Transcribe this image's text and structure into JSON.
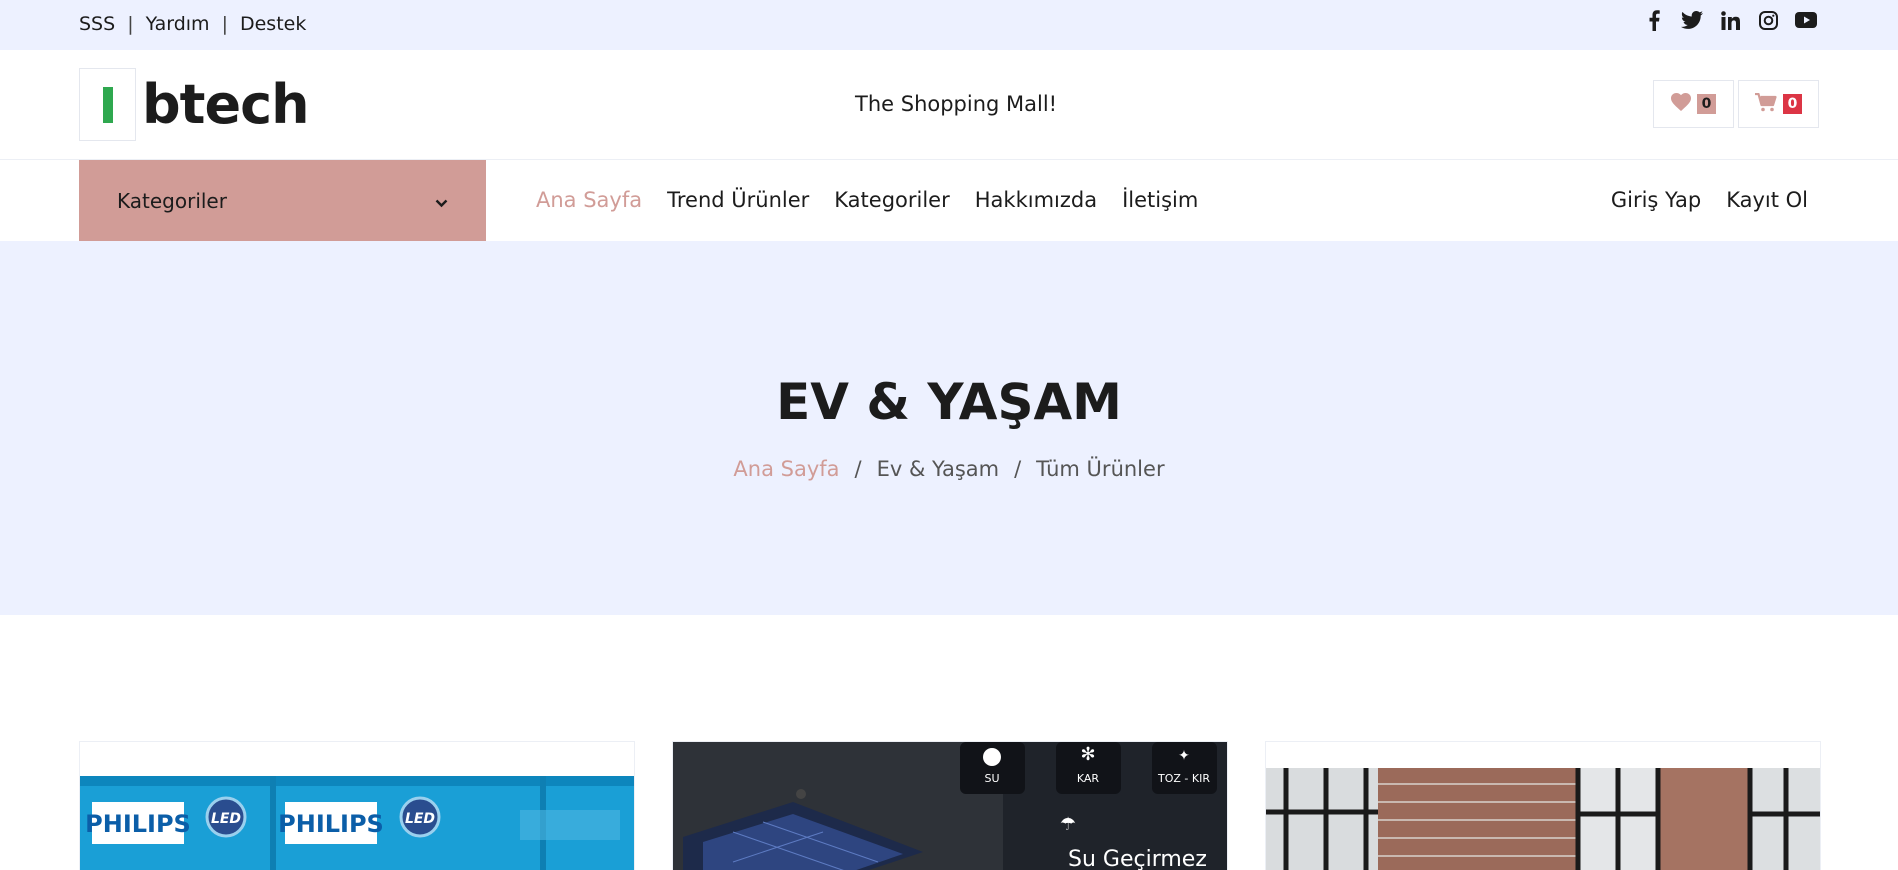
{
  "topbar": {
    "links": [
      "SSS",
      "Yardım",
      "Destek"
    ],
    "separator": "|",
    "social_icons": [
      "facebook-icon",
      "twitter-icon",
      "linkedin-icon",
      "instagram-icon",
      "youtube-icon"
    ]
  },
  "header": {
    "logo_text": "btech",
    "tagline": "The Shopping Mall!",
    "wishlist_count": "0",
    "cart_count": "0"
  },
  "nav": {
    "categories_label": "Kategoriler",
    "menu": [
      "Ana Sayfa",
      "Trend Ürünler",
      "Kategoriler",
      "Hakkımızda",
      "İletişim"
    ],
    "active_item": "Ana Sayfa",
    "login_label": "Giriş Yap",
    "register_label": "Kayıt Ol"
  },
  "hero": {
    "title": "EV & YAŞAM",
    "breadcrumb": [
      "Ana Sayfa",
      "Ev & Yaşam",
      "Tüm Ürünler"
    ],
    "breadcrumb_separator": "/"
  },
  "products": {
    "card1_texts": [
      "PHILIPS",
      "LED",
      "PHILIPS",
      "LED"
    ],
    "card2_texts": [
      "SU",
      "KAR",
      "TOZ - KIR",
      "Su Geçirmez"
    ]
  },
  "colors": {
    "accent": "#d19c97",
    "topbar_bg": "#edf1ff",
    "logo_green": "#2fa84f",
    "cart_badge": "#dc3545",
    "text": "#1c1c1c"
  }
}
